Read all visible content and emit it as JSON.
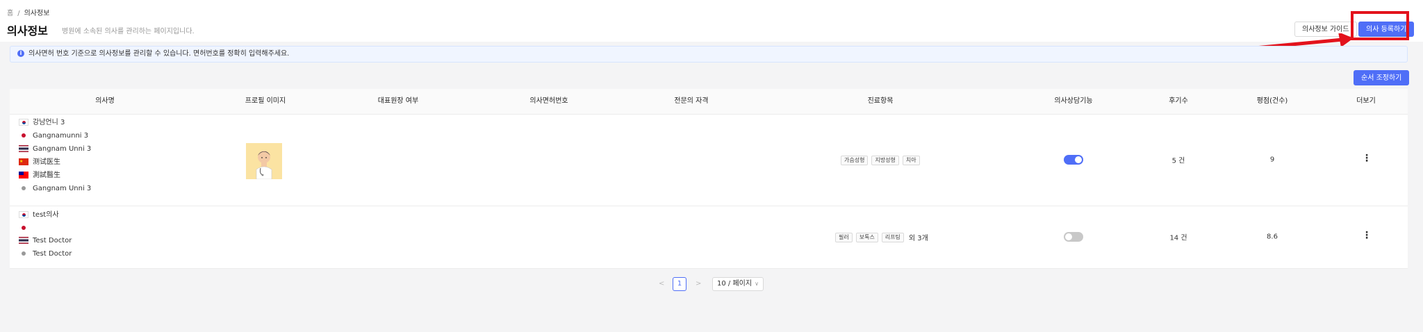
{
  "breadcrumb": {
    "home": "홈",
    "separator": "/",
    "current": "의사정보"
  },
  "header": {
    "title": "의사정보",
    "subtitle": "병원에 소속된 의사를 관리하는 페이지입니다.",
    "guide_button": "의사정보 가이드",
    "register_button": "의사 등록하기"
  },
  "notice": {
    "icon": "info-icon",
    "text": "의사면허 번호 기준으로 의사정보를 관리할 수 있습니다. 면허번호를 정확히 입력해주세요."
  },
  "order_button": "순서 조정하기",
  "table": {
    "columns": [
      "의사명",
      "프로필 이미지",
      "대표원장 여부",
      "의사면허번호",
      "전문의 자격",
      "진료항목",
      "의사상담기능",
      "후기수",
      "평점(건수)",
      "더보기"
    ],
    "rows": [
      {
        "names": [
          {
            "flag": "kr",
            "name": "강남언니 3"
          },
          {
            "flag": "jp",
            "name": "Gangnamunni 3"
          },
          {
            "flag": "th",
            "name": "Gangnam Unni 3"
          },
          {
            "flag": "cn",
            "name": "测试医生"
          },
          {
            "flag": "tw",
            "name": "測試醫生"
          },
          {
            "flag": "global",
            "name": "Gangnam Unni 3"
          }
        ],
        "has_profile_image": true,
        "treatments": [
          "가슴성형",
          "지방성형",
          "치아"
        ],
        "treatments_more": "",
        "consultation_enabled": true,
        "review_count": "5 건",
        "rating": "9"
      },
      {
        "names": [
          {
            "flag": "kr",
            "name": "test의사"
          },
          {
            "flag": "jp",
            "name": ""
          },
          {
            "flag": "th",
            "name": "Test Doctor"
          },
          {
            "flag": "global",
            "name": "Test Doctor"
          }
        ],
        "has_profile_image": false,
        "treatments": [
          "필러",
          "보톡스",
          "리프팅"
        ],
        "treatments_more": "외 3개",
        "consultation_enabled": false,
        "review_count": "14 건",
        "rating": "8.6"
      }
    ]
  },
  "pagination": {
    "prev": "<",
    "current_page": "1",
    "next": ">",
    "page_size": "10 / 페이지"
  },
  "colors": {
    "primary": "#4f6ef7",
    "highlight": "#e3121c",
    "notice_bg": "#f0f5ff"
  }
}
